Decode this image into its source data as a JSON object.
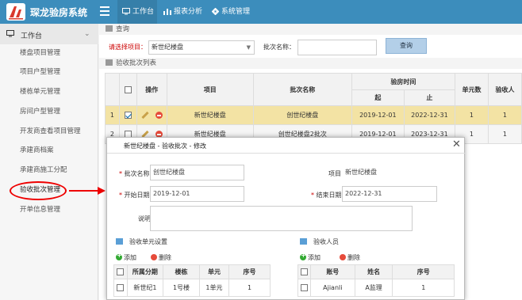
{
  "app": {
    "title": "琛龙验房系统"
  },
  "nav": {
    "tabs": [
      {
        "label": "工作台"
      },
      {
        "label": "报表分析"
      },
      {
        "label": "系统管理"
      }
    ]
  },
  "sidebar": {
    "header": "工作台",
    "items": [
      {
        "label": "楼盘项目管理"
      },
      {
        "label": "项目户型管理"
      },
      {
        "label": "楼栋单元管理"
      },
      {
        "label": "房间户型管理"
      },
      {
        "label": "开发商查看项目管理"
      },
      {
        "label": "承建商档案"
      },
      {
        "label": "承建商施工分配"
      },
      {
        "label": "验收批次管理"
      },
      {
        "label": "开单信息管理"
      }
    ]
  },
  "query": {
    "section_title": "查询",
    "project_label": "请选择项目：",
    "project_value": "新世纪楼盘",
    "batch_label": "批次名称：",
    "batch_value": "",
    "button": "查询"
  },
  "list": {
    "section_title": "验收批次列表",
    "headers": {
      "op": "操作",
      "project": "项目",
      "batch": "批次名称",
      "time": "验房时间",
      "start": "起",
      "end": "止",
      "units": "单元数",
      "inspectors": "验收人"
    },
    "rows": [
      {
        "num": "1",
        "checked": true,
        "project": "新世纪楼盘",
        "batch": "创世纪楼盘",
        "start": "2019-12-01",
        "end": "2022-12-31",
        "units": "1",
        "inspectors": "1"
      },
      {
        "num": "2",
        "checked": false,
        "project": "新世纪楼盘",
        "batch": "创世纪楼盘2批次",
        "start": "2019-12-01",
        "end": "2023-12-31",
        "units": "1",
        "inspectors": "1"
      }
    ]
  },
  "dialog": {
    "title": "新世纪楼盘 - 验收批次 - 修改",
    "batch_label": "批次名称",
    "batch_value": "创世纪楼盘",
    "project_label": "项目",
    "project_value": "新世纪楼盘",
    "start_label": "开始日期",
    "start_value": "2019-12-01",
    "end_label": "结束日期",
    "end_value": "2022-12-31",
    "desc_label": "说明",
    "desc_value": "",
    "units_title": "验收单元设置",
    "inspectors_title": "验收人员",
    "add_label": "添加",
    "delete_label": "删除",
    "units_headers": [
      "所属分期",
      "楼栋",
      "单元",
      "序号"
    ],
    "units_rows": [
      {
        "phase": "新世纪1",
        "building": "1号楼",
        "unit": "1单元",
        "seq": "1"
      }
    ],
    "inspectors_headers": [
      "账号",
      "姓名",
      "序号"
    ],
    "inspectors_rows": [
      {
        "account": "Ajianli",
        "name": "A监理",
        "seq": "1"
      }
    ]
  },
  "colors": {
    "topbar": "#3c8dbc",
    "highlight_row": "#f3e3a4",
    "annotation": "#e00000"
  }
}
